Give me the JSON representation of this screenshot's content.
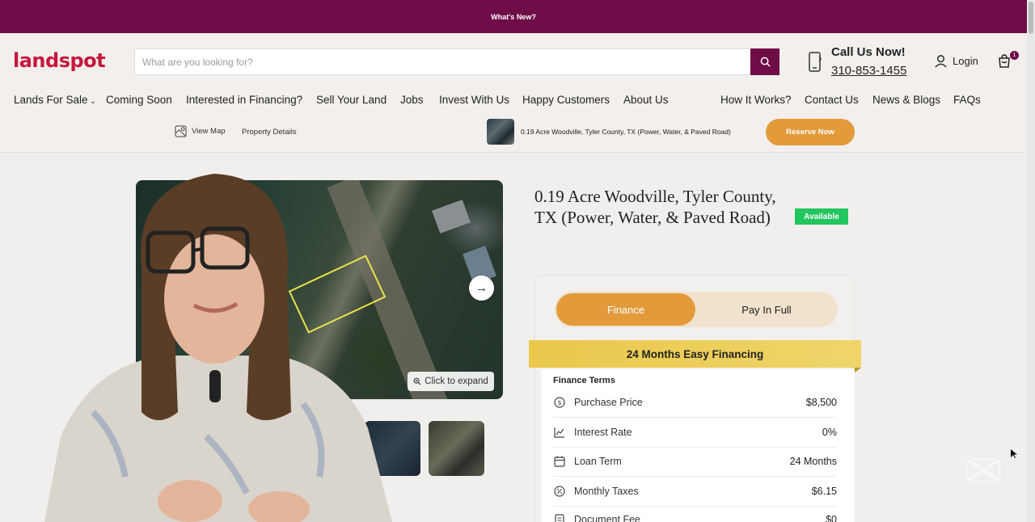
{
  "announcement": "What's New?",
  "logo": "landspot",
  "search": {
    "placeholder": "What are you looking for?"
  },
  "contact": {
    "label": "Call Us Now!",
    "phone": "310-853-1455"
  },
  "account": {
    "login_label": "Login",
    "cart_count": "1"
  },
  "nav": {
    "items": [
      "Lands For Sale",
      "Coming Soon",
      "Interested in Financing?",
      "Sell Your Land",
      "Jobs",
      "Invest With Us",
      "Happy Customers",
      "About Us",
      "How It Works?",
      "Contact Us",
      "News & Blogs",
      "FAQs"
    ]
  },
  "subnav": {
    "view_map": "View Map",
    "property_details": "Property Details",
    "listing_title": "0.19 Acre Woodville, Tyler County, TX (Power, Water, & Paved Road)",
    "reserve_label": "Reserve Now"
  },
  "gallery": {
    "expand_label": "Click to expand"
  },
  "listing": {
    "title": "0.19 Acre Woodville, Tyler County, TX (Power, Water, & Paved Road)",
    "status": "Available"
  },
  "payment": {
    "finance_label": "Finance",
    "full_label": "Pay In Full",
    "ribbon": "24 Months Easy Financing",
    "terms_title": "Finance Terms",
    "terms": [
      {
        "icon": "dollar-circle-icon",
        "label": "Purchase Price",
        "value": "$8,500"
      },
      {
        "icon": "chart-line-icon",
        "label": "Interest Rate",
        "value": "0%"
      },
      {
        "icon": "calendar-icon",
        "label": "Loan Term",
        "value": "24 Months"
      },
      {
        "icon": "tax-icon",
        "label": "Monthly Taxes",
        "value": "$6.15"
      },
      {
        "icon": "document-icon",
        "label": "Document Fee",
        "value": "$0"
      }
    ]
  },
  "colors": {
    "brand": "#6e0d47",
    "accent": "#e39a3a",
    "logo": "#c7173b",
    "available": "#22c55e",
    "ribbon": "#e9c84a"
  }
}
